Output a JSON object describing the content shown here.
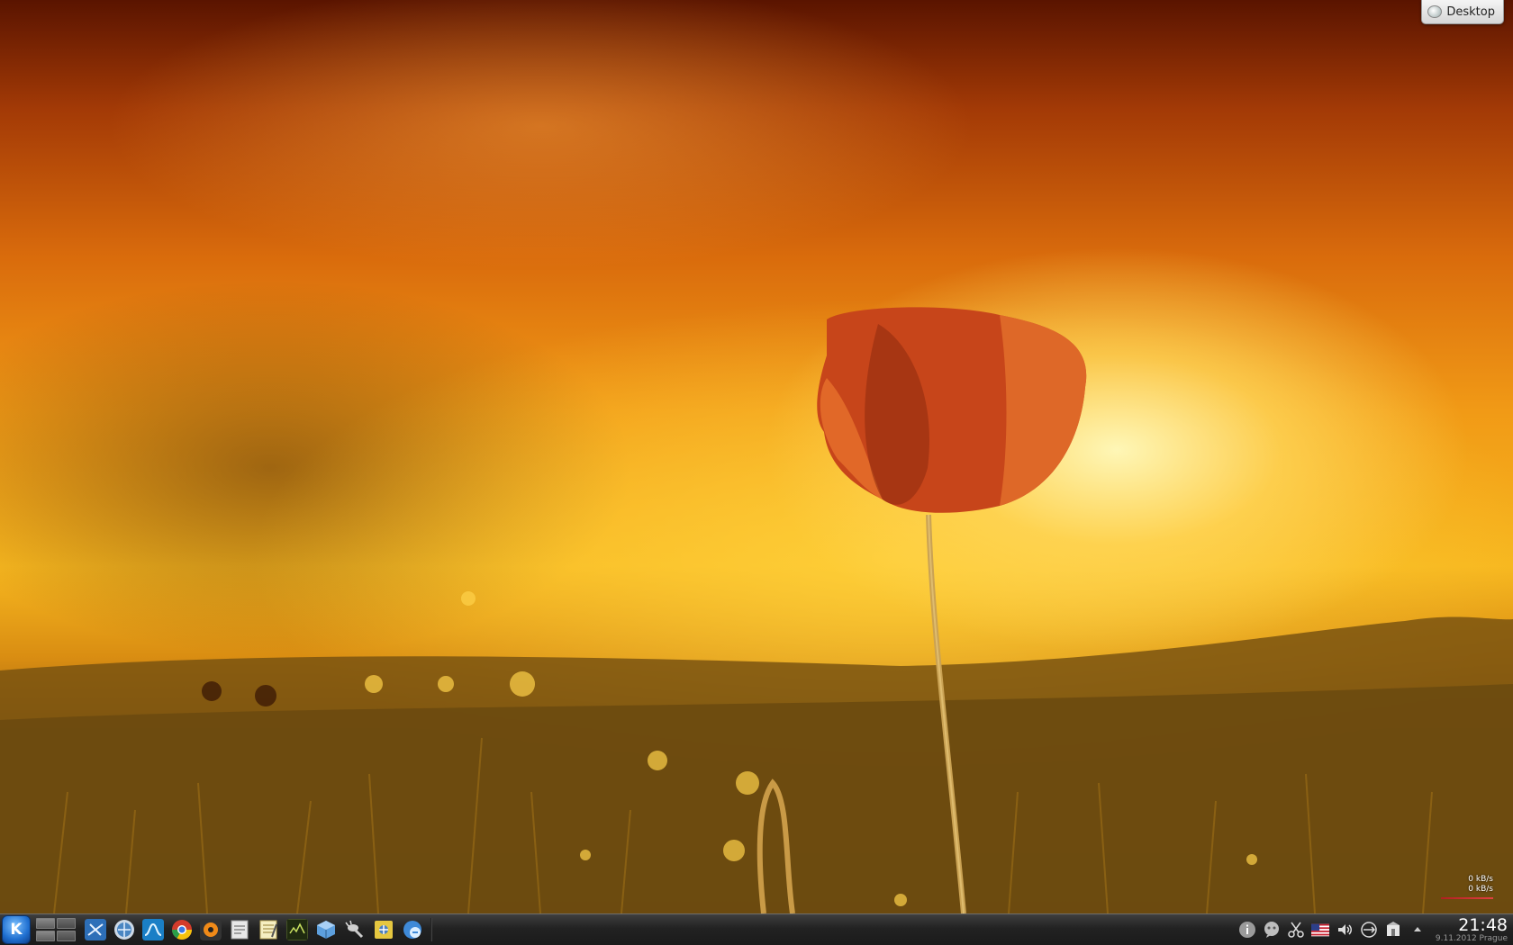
{
  "desktop": {
    "toolbox_label": "Desktop",
    "net_monitor": {
      "download": "0 kB/s",
      "upload": "0 kB/s"
    }
  },
  "panel": {
    "launcher": {
      "icon": "kde-kickoff-icon"
    },
    "pager": {
      "desktops": 2
    },
    "taskbar_launchers": [
      {
        "icon": "system-settings-icon"
      },
      {
        "icon": "web-browser-globe-icon"
      },
      {
        "icon": "system-monitor-icon"
      },
      {
        "icon": "chrome-icon"
      },
      {
        "icon": "media-player-icon"
      },
      {
        "icon": "text-document-icon"
      },
      {
        "icon": "notes-icon"
      },
      {
        "icon": "terminal-icon"
      },
      {
        "icon": "virtualbox-icon"
      },
      {
        "icon": "wine-icon"
      },
      {
        "icon": "file-manager-icon"
      },
      {
        "icon": "network-manager-icon"
      }
    ],
    "tray": [
      {
        "icon": "info-icon"
      },
      {
        "icon": "chat-icon"
      },
      {
        "icon": "scissors-icon"
      },
      {
        "icon": "us-flag-icon"
      },
      {
        "icon": "volume-icon"
      },
      {
        "icon": "device-notifier-icon"
      },
      {
        "icon": "package-updater-icon"
      },
      {
        "icon": "tray-expand-icon"
      }
    ],
    "clock": {
      "time": "21:48",
      "date": "9.11.2012 Prague"
    }
  }
}
